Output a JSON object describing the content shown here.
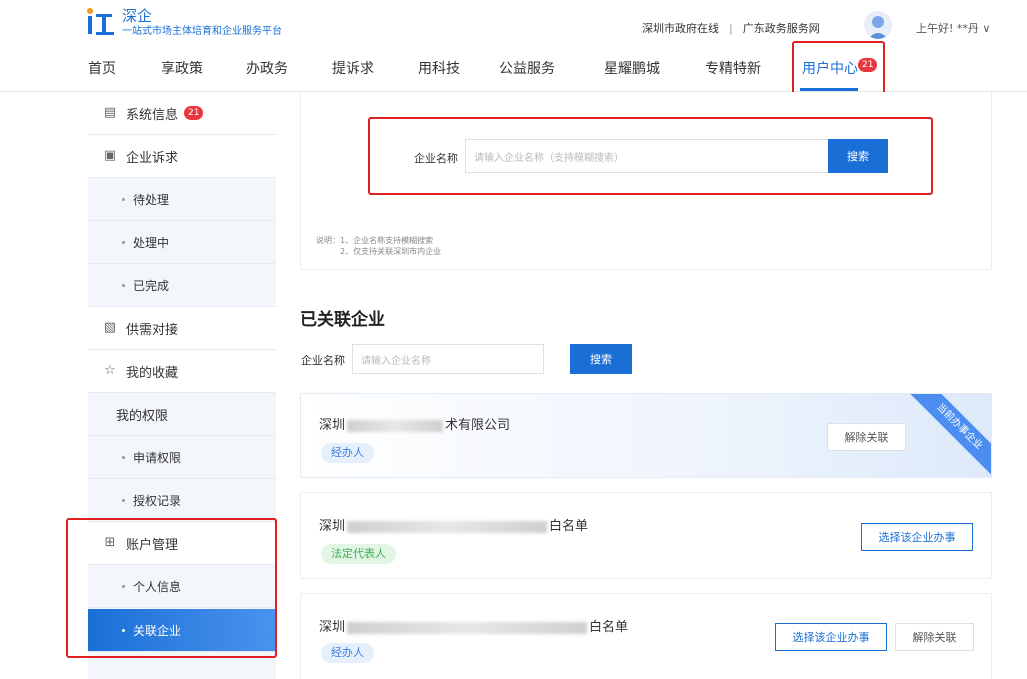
{
  "header": {
    "logo_title": "深企",
    "logo_subtitle": "一站式市场主体培育和企业服务平台",
    "links": [
      "深圳市政府在线",
      "广东政务服务网"
    ],
    "link_separator": "|",
    "greeting": "上午好! **丹 ∨"
  },
  "nav": {
    "items": [
      "首页",
      "享政策",
      "办政务",
      "提诉求",
      "用科技",
      "公益服务",
      "星耀鹏城",
      "专精特新",
      "用户中心"
    ],
    "active_badge": "21"
  },
  "sidebar": {
    "system_info": "系统信息",
    "system_info_badge": "21",
    "enterprise_appeal": "企业诉求",
    "pending": "待处理",
    "processing": "处理中",
    "completed": "已完成",
    "supply_demand": "供需对接",
    "favorites": "我的收藏",
    "permissions": "我的权限",
    "apply_permission": "申请权限",
    "auth_records": "授权记录",
    "account_mgmt": "账户管理",
    "personal_info": "个人信息",
    "linked_enterprise": "关联企业"
  },
  "search": {
    "label": "企业名称",
    "placeholder": "请输入企业名称（支持模糊搜索）",
    "button": "搜索",
    "note_line1": "说明：1、企业名称支持模糊搜索",
    "note_line2": "2、仅支持关联深圳市内企业"
  },
  "linked": {
    "title": "已关联企业",
    "filter_label": "企业名称",
    "filter_placeholder": "请输入企业名称",
    "filter_button": "搜索"
  },
  "cards": [
    {
      "name_prefix": "深圳",
      "name_suffix": "术有限公司",
      "role": "经办人",
      "ribbon": "当前办事企业",
      "action_unlink": "解除关联"
    },
    {
      "name_prefix": "深圳",
      "name_suffix": "白名单",
      "role": "法定代表人",
      "action_select": "选择该企业办事"
    },
    {
      "name_prefix": "深圳",
      "name_suffix": "白名单",
      "role": "经办人",
      "action_select": "选择该企业办事",
      "action_unlink": "解除关联"
    }
  ],
  "colors": {
    "primary": "#1a6fd6",
    "badge": "#e8383d",
    "highlight": "#e02020"
  }
}
